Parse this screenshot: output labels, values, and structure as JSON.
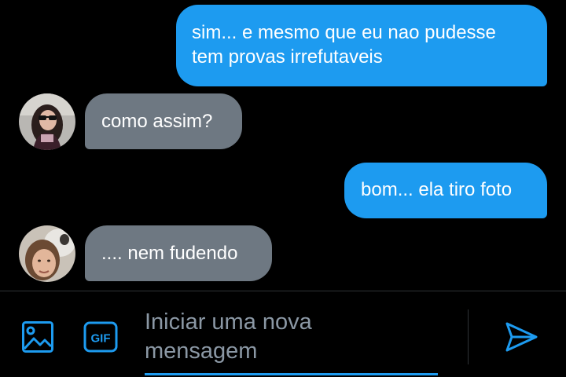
{
  "messages": [
    {
      "direction": "sent",
      "text": "sim... e mesmo que eu nao pudesse\ntem provas irrefutaveis"
    },
    {
      "direction": "received",
      "text": "como assim?"
    },
    {
      "direction": "sent",
      "text": "bom... ela tiro foto"
    },
    {
      "direction": "received",
      "text": ".... nem fudendo"
    }
  ],
  "composer": {
    "placeholder": "Iniciar uma nova\nmensagem",
    "image_icon": "image-icon",
    "gif_icon": "gif-icon",
    "gif_label": "GIF",
    "send_icon": "send-icon"
  },
  "colors": {
    "background": "#000000",
    "sent_bubble": "#1d9bf0",
    "received_bubble": "#6e7882",
    "accent": "#1d9bf0",
    "placeholder": "#8b98a5"
  }
}
